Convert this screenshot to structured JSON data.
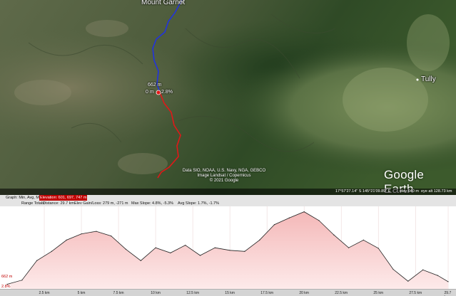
{
  "map": {
    "places": {
      "mount_garnet": "Mount Garnet",
      "tully": "Tully"
    },
    "route_labels": {
      "elev_marker": "662 m",
      "start_marker": "0 m",
      "slope_marker": "2.8%"
    },
    "attribution": [
      "Data SIO, NOAA, U.S. Navy, NGA, GEBCO",
      "Image Landsat / Copernicus",
      "© 2021 Google"
    ],
    "brand": "Google Earth",
    "status": {
      "coords": "17°57'27.14\" S   145°21'09.89\" E",
      "elev": "elev   640 m",
      "eye_alt": "eye alt 128.73 km"
    },
    "colors": {
      "route_up": "#2233dd",
      "route_down": "#e01818"
    }
  },
  "profile": {
    "header": {
      "graph_label": "Graph: Min, Avg, Max",
      "elevation_label": "Elevation: 601, 697, 747 m",
      "range_totals": "Range Totals:",
      "distance": "Distance: 29.7 km",
      "gain_loss": "Elev Gain/Loss: 279 m, -271 m",
      "max_slope": "Max Slope: 4.8%, -5.3%",
      "avg_slope": "Avg Slope: 1.7%, -1.7%"
    },
    "left_readouts": {
      "elev": "662 m",
      "slope": "2.8%"
    },
    "x_ticks": [
      "2.5 km",
      "5 km",
      "7.5 km",
      "10 km",
      "12.5 km",
      "15 km",
      "17.5 km",
      "20 km",
      "22.5 km",
      "25 km",
      "27.5 km",
      "29.7 km"
    ],
    "colors": {
      "fill_top": "#f4b8b8",
      "fill_bottom": "#fdeaea",
      "line": "#222222"
    }
  },
  "chart_data": {
    "type": "area",
    "xlabel": "",
    "ylabel": "",
    "x": [
      0,
      1,
      2,
      3,
      4,
      5,
      6,
      7,
      8,
      9,
      10,
      11,
      12,
      13,
      14,
      15,
      16,
      17,
      18,
      19,
      20,
      21,
      22,
      23,
      24,
      25,
      26,
      27,
      28,
      29,
      29.7
    ],
    "y": [
      604,
      612,
      650,
      668,
      690,
      702,
      707,
      698,
      672,
      650,
      675,
      665,
      680,
      660,
      675,
      670,
      668,
      690,
      720,
      733,
      745,
      728,
      700,
      675,
      690,
      674,
      633,
      610,
      632,
      621,
      609
    ],
    "xlim": [
      0,
      29.7
    ],
    "ylim": [
      595,
      750
    ],
    "summary": {
      "min": 601,
      "avg": 697,
      "max": 747
    }
  }
}
